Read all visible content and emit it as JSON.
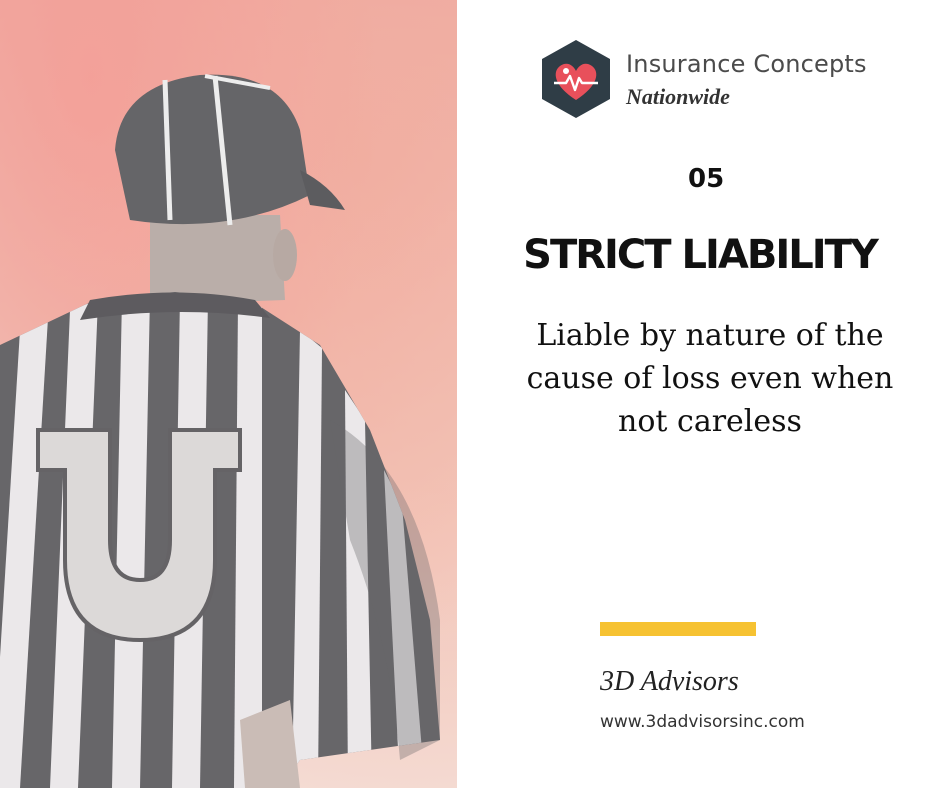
{
  "logo": {
    "title": "Insurance Concepts",
    "subtitle": "Nationwide",
    "icon": "heart-pulse-icon",
    "hex_color": "#2f3d46",
    "heart_color": "#e8505b"
  },
  "slide": {
    "number": "05",
    "heading": "STRICT LIABILITY",
    "description": "Liable by nature of the cause of loss even when not careless"
  },
  "footer": {
    "company": "3D Advisors",
    "website": "www.3dadvisorsinc.com",
    "accent_color": "#f6c232"
  }
}
